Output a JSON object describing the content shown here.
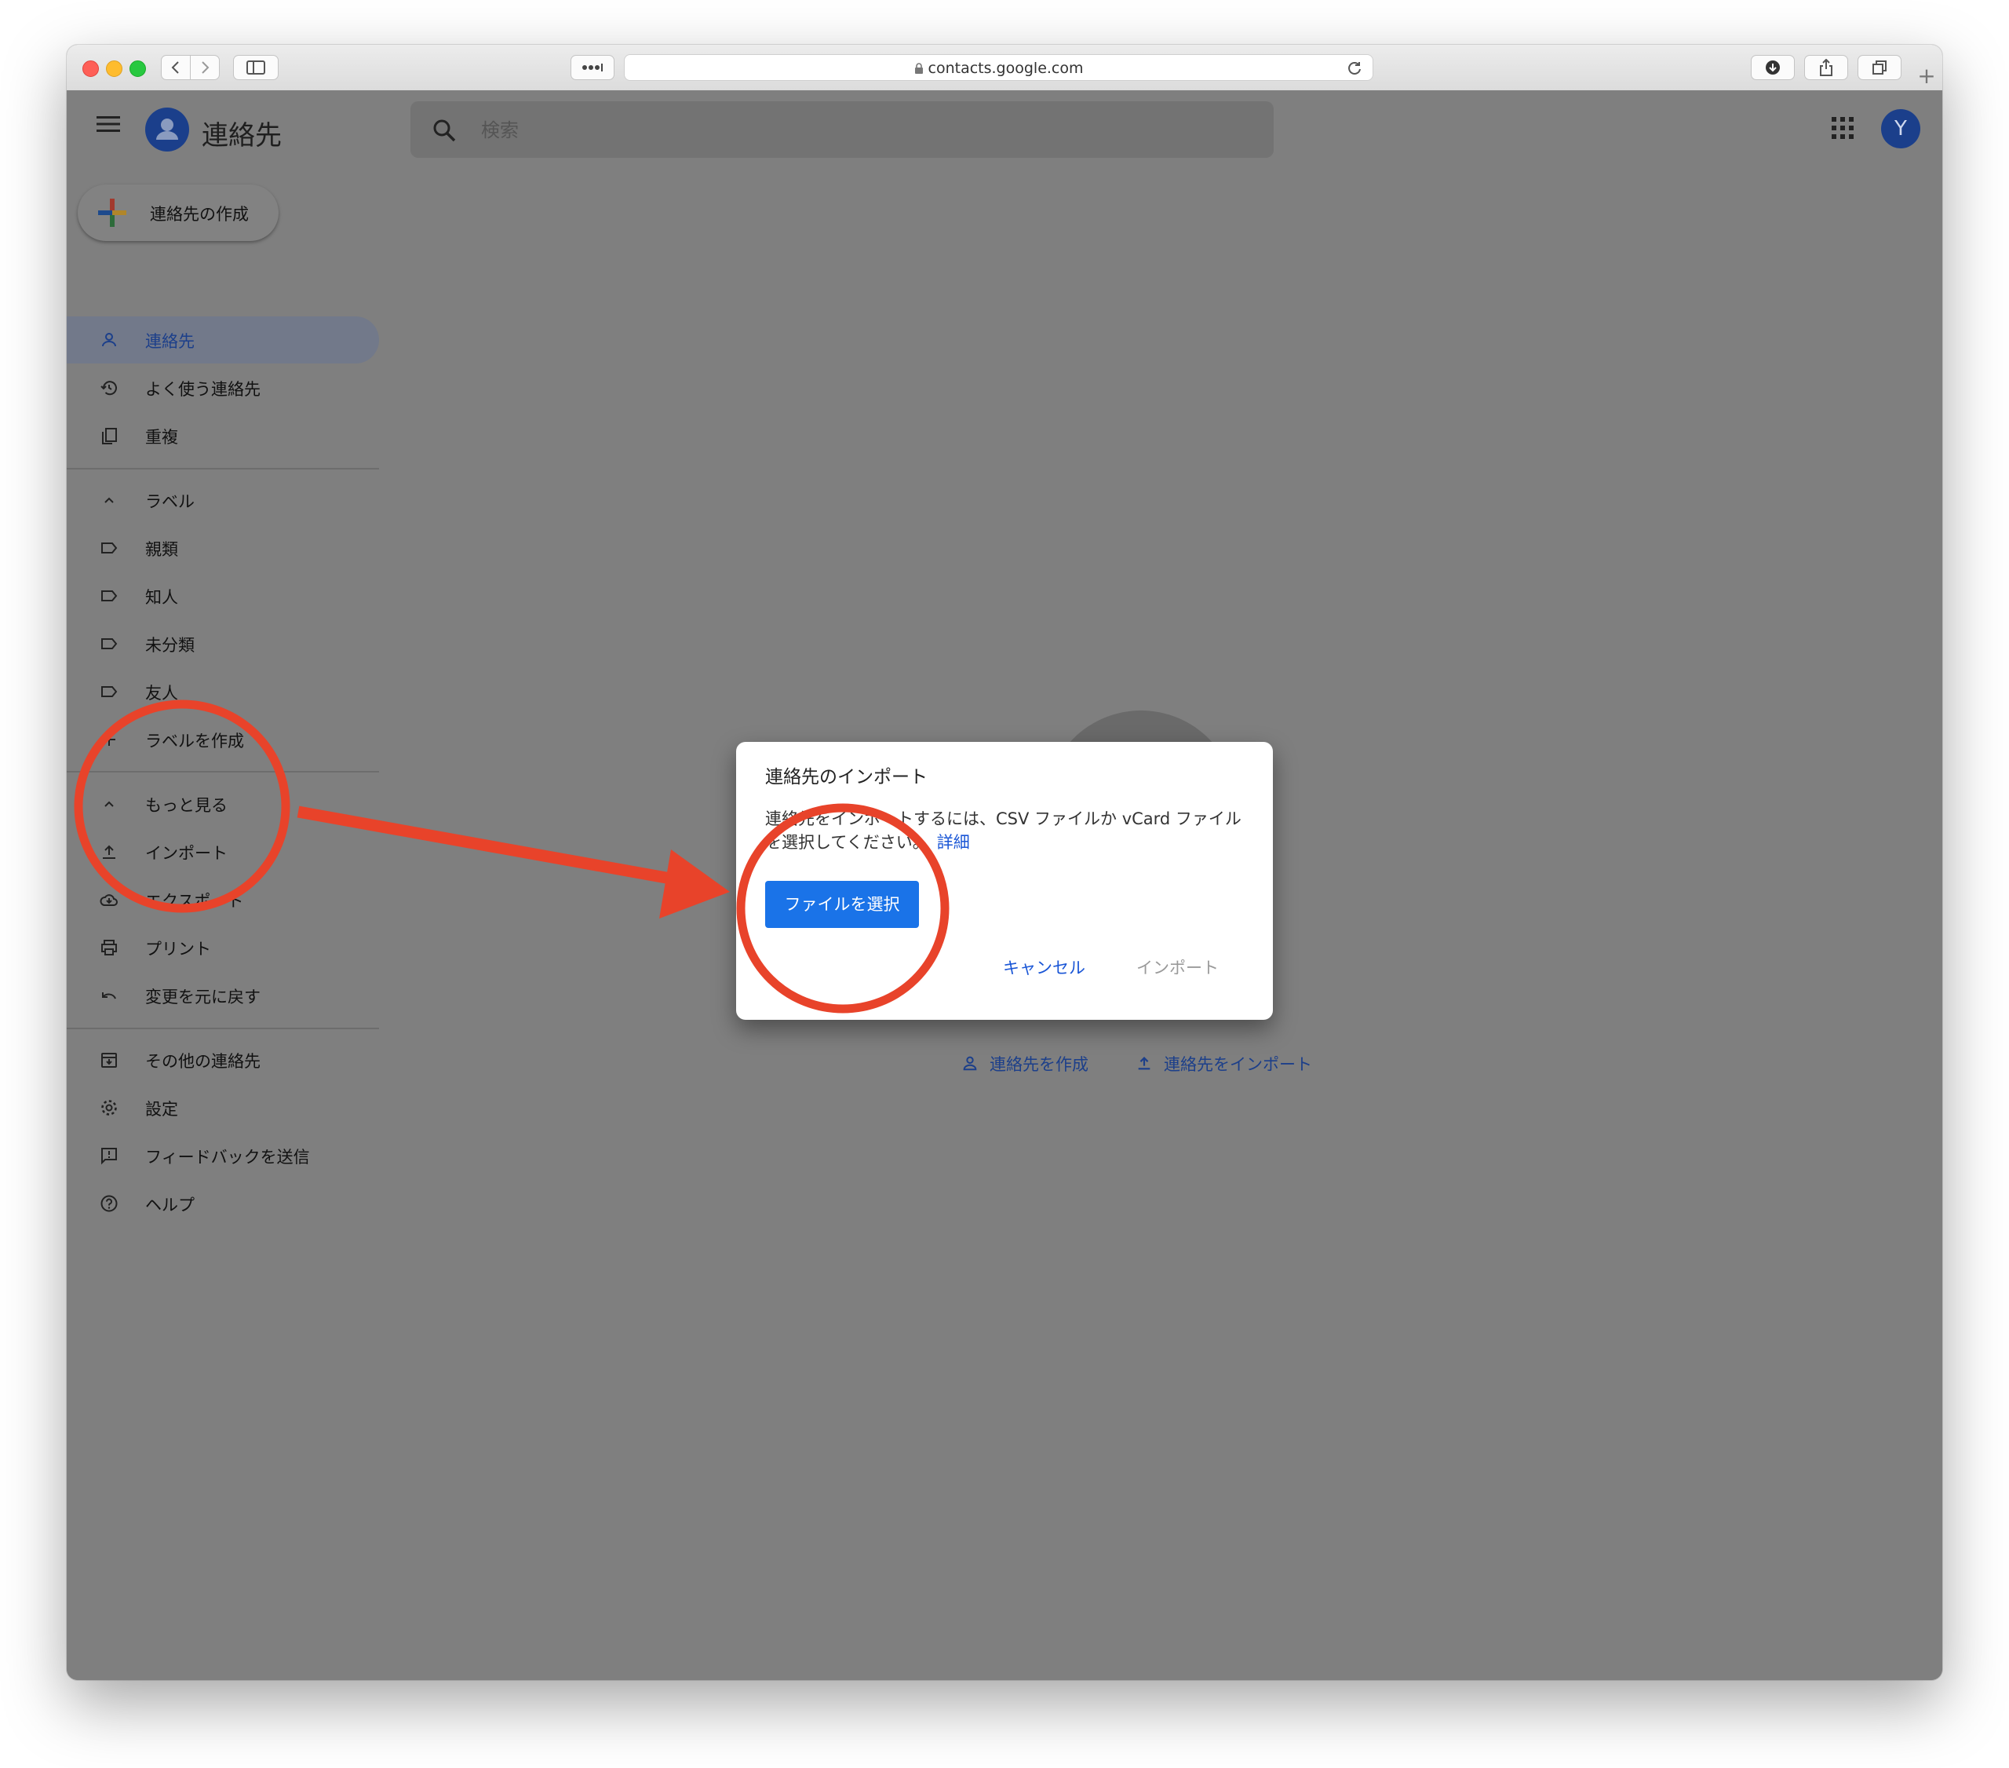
{
  "browser": {
    "url": "contacts.google.com"
  },
  "header": {
    "app_title": "連絡先",
    "search_placeholder": "検索",
    "avatar_initial": "Y"
  },
  "sidebar": {
    "create_label": "連絡先の作成",
    "items": [
      {
        "label": "連絡先",
        "icon": "person-icon"
      },
      {
        "label": "よく使う連絡先",
        "icon": "history-icon"
      },
      {
        "label": "重複",
        "icon": "copy-icon"
      },
      {
        "label": "ラベル",
        "icon": "chevron-up-icon"
      },
      {
        "label": "親類",
        "icon": "label-icon"
      },
      {
        "label": "知人",
        "icon": "label-icon"
      },
      {
        "label": "未分類",
        "icon": "label-icon"
      },
      {
        "label": "友人",
        "icon": "label-icon"
      },
      {
        "label": "ラベルを作成",
        "icon": "plus-icon"
      },
      {
        "label": "もっと見る",
        "icon": "chevron-up-icon"
      },
      {
        "label": "インポート",
        "icon": "upload-icon"
      },
      {
        "label": "エクスポート",
        "icon": "cloud-download-icon"
      },
      {
        "label": "プリント",
        "icon": "print-icon"
      },
      {
        "label": "変更を元に戻す",
        "icon": "undo-icon"
      },
      {
        "label": "その他の連絡先",
        "icon": "archive-icon"
      },
      {
        "label": "設定",
        "icon": "gear-icon"
      },
      {
        "label": "フィードバックを送信",
        "icon": "feedback-icon"
      },
      {
        "label": "ヘルプ",
        "icon": "help-icon"
      }
    ]
  },
  "empty_state": {
    "create_link": "連絡先を作成",
    "import_link": "連絡先をインポート"
  },
  "dialog": {
    "title": "連絡先のインポート",
    "body": "連絡先をインポートするには、CSV ファイルか vCard ファイルを選択してください。",
    "link": "詳細",
    "file_button": "ファイルを選択",
    "cancel": "キャンセル",
    "import": "インポート"
  },
  "colors": {
    "overlay": "#7f7f7f",
    "primary": "#1a73e8",
    "annotation": "#e8432a"
  }
}
